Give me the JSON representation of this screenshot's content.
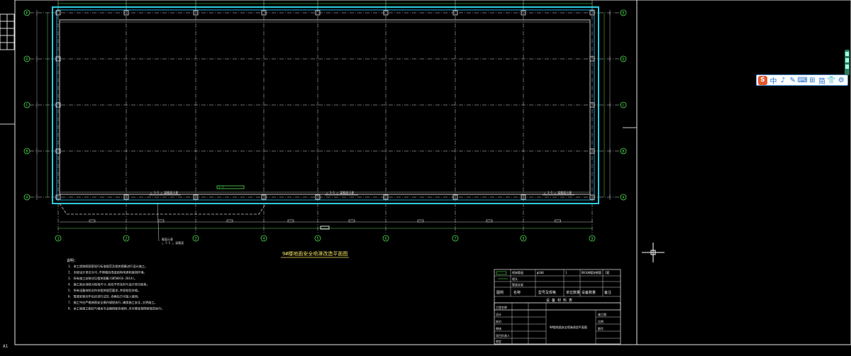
{
  "drawing": {
    "title": "9#楼地面安全喷淋改造平面图",
    "grid_rows": [
      "E",
      "D",
      "C",
      "B",
      "A"
    ],
    "grid_cols": [
      "1",
      "2",
      "3",
      "4",
      "5",
      "6",
      "7",
      "8",
      "9"
    ],
    "section_callout": "1-1",
    "beam_note_left": "△ 1-1 △ 梁截面示意",
    "beam_note_mid": "△ 1-1 △ 梁截面示意",
    "beam_note_right": "△ 1-1 △ 梁截面示意",
    "bottom_label": "截面示意",
    "bottom_label_sub": "△ 1-1 △ 梁截面",
    "symbol_tag": "A1",
    "notes_heading": "说明:",
    "notes": [
      "1. 本工程按照国家现行标准规范及相关图集进行设计施工。",
      "2. 未经设计单位许可,不得擅自改变结构用途和使用环境。",
      "3. 所有施工安装详见相关图集(GB50016-2014)。",
      "4. 施工前必须核对现场尺寸,如有不符及时与设计单位联系。",
      "5. 所有设备材料应符合相关规范要求,并经检验合格。",
      "6. 管道安装完毕后应进行试压,合格后方可投入使用。",
      "7. 施工中应严格按照安全操作规程执行,确保施工安全,文明施工。",
      "8. 本工程施工图应与相关专业图纸配合使用,未尽事宜按国家规范执行。"
    ]
  },
  "legend_table": {
    "rows": [
      [
        "",
        "喷淋管道",
        "ф100",
        "1",
        "DN100镀锌钢管",
        ""
      ],
      [
        "",
        "喷头",
        "",
        "",
        "",
        ""
      ],
      [
        "",
        "管道支架",
        "",
        "",
        "",
        ""
      ]
    ],
    "header": [
      "图例",
      "名称",
      "型号及规格",
      "单位数量",
      "设备数量",
      "备注"
    ],
    "table_title": "设 备 材 料 表",
    "count_label": "1套"
  },
  "title_block": {
    "rows": [
      "设计",
      "校对",
      "审核",
      "项目负责人",
      "审定"
    ],
    "project_label": "工程名称",
    "drawing_name": "9#楼地面安全喷淋改造平面图",
    "stage_label": "施工图",
    "scale_label": "比例",
    "sheet_label": "图号"
  },
  "ui": {
    "ime_logo": "S",
    "ime_items": [
      "中",
      "♪",
      "✎",
      "⌨",
      "⊞",
      "简",
      "👕",
      "⚙"
    ],
    "cursor_crosshair": "+"
  }
}
